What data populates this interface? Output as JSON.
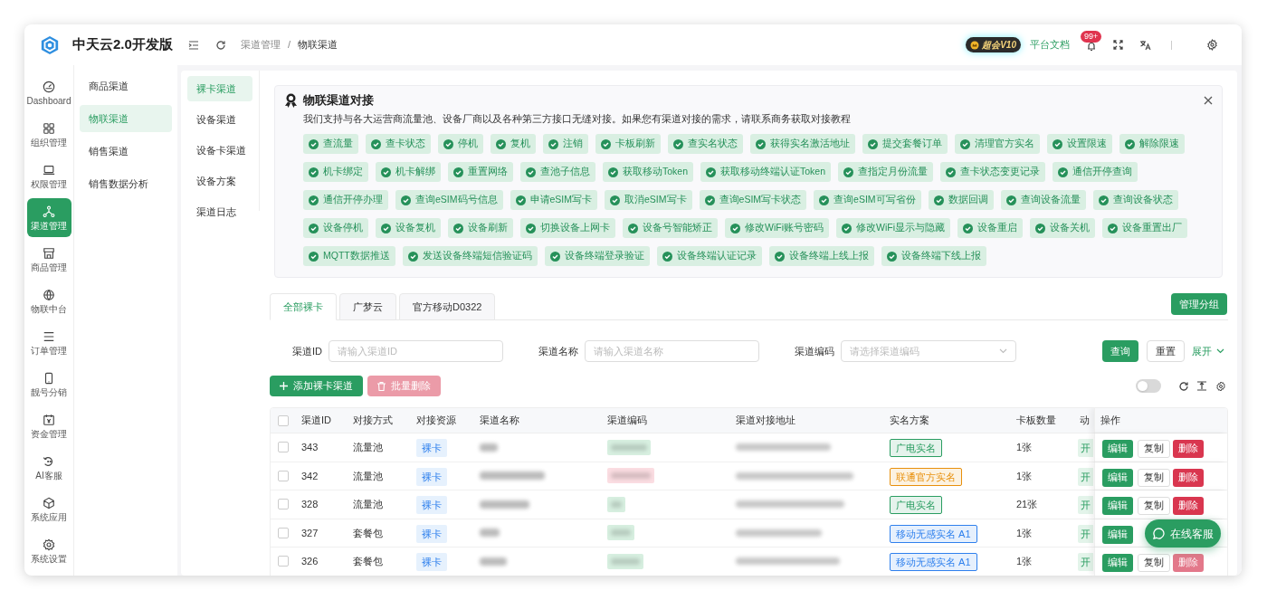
{
  "app": {
    "title": "中天云2.0开发版"
  },
  "rail": [
    {
      "label": "Dashboard",
      "selected": false
    },
    {
      "label": "组织管理",
      "selected": false
    },
    {
      "label": "权限管理",
      "selected": false
    },
    {
      "label": "渠道管理",
      "selected": true
    },
    {
      "label": "商品管理",
      "selected": false
    },
    {
      "label": "物联中台",
      "selected": false
    },
    {
      "label": "订单管理",
      "selected": false
    },
    {
      "label": "靓号分销",
      "selected": false
    },
    {
      "label": "资金管理",
      "selected": false
    },
    {
      "label": "AI客服",
      "selected": false
    },
    {
      "label": "系统应用",
      "selected": false
    },
    {
      "label": "系统设置",
      "selected": false
    }
  ],
  "submenu": [
    {
      "label": "商品渠道",
      "selected": false
    },
    {
      "label": "物联渠道",
      "selected": true
    },
    {
      "label": "销售渠道",
      "selected": false
    },
    {
      "label": "销售数据分析",
      "selected": false
    }
  ],
  "breadcrumb": [
    "渠道管理",
    "/",
    "物联渠道"
  ],
  "header": {
    "vip_badge": "超会V10",
    "docs_link": "平台文档",
    "notification_count": "99+"
  },
  "channel_menu": [
    {
      "label": "裸卡渠道",
      "selected": true
    },
    {
      "label": "设备渠道",
      "selected": false
    },
    {
      "label": "设备卡渠道",
      "selected": false
    },
    {
      "label": "设备方案",
      "selected": false
    },
    {
      "label": "渠道日志",
      "selected": false
    }
  ],
  "notice": {
    "title": "物联渠道对接",
    "description": "我们支持与各大运营商流量池、设备厂商以及各种第三方接口无缝对接。如果您有渠道对接的需求，请联系商务获取对接教程",
    "capabilities": [
      "查流量",
      "查卡状态",
      "停机",
      "复机",
      "注销",
      "卡板刷新",
      "查实名状态",
      "获得实名激活地址",
      "提交套餐订单",
      "清理官方实名",
      "设置限速",
      "解除限速",
      "机卡绑定",
      "机卡解绑",
      "重置网络",
      "查池子信息",
      "获取移动Token",
      "获取移动终端认证Token",
      "查指定月份流量",
      "查卡状态变更记录",
      "通信开停查询",
      "通信开停办理",
      "查询eSIM码号信息",
      "申请eSIM写卡",
      "取消eSIM写卡",
      "查询eSIM写卡状态",
      "查询eSIM可写省份",
      "数据回调",
      "查询设备流量",
      "查询设备状态",
      "设备停机",
      "设备复机",
      "设备刷新",
      "切换设备上网卡",
      "设备号智能矫正",
      "修改WiFi账号密码",
      "修改WiFi显示与隐藏",
      "设备重启",
      "设备关机",
      "设备重置出厂",
      "MQTT数据推送",
      "发送设备终端短信验证码",
      "设备终端登录验证",
      "设备终端认证记录",
      "设备终端上线上报",
      "设备终端下线上报"
    ]
  },
  "group_tabs": [
    {
      "label": "全部裸卡",
      "selected": true
    },
    {
      "label": "广梦云",
      "selected": false
    },
    {
      "label": "官方移动D0322",
      "selected": false
    }
  ],
  "manage_groups_button": "管理分组",
  "filters": [
    {
      "label": "渠道ID",
      "kind": "input",
      "placeholder": "请输入渠道ID"
    },
    {
      "label": "渠道名称",
      "kind": "input",
      "placeholder": "请输入渠道名称"
    },
    {
      "label": "渠道编码",
      "kind": "select",
      "placeholder": "请选择渠道编码"
    }
  ],
  "filter_actions": {
    "search": "查询",
    "reset": "重置",
    "expand": "展开"
  },
  "toolbar": {
    "add": {
      "label": "添加裸卡渠道",
      "disabled": false
    },
    "batch_delete": {
      "label": "批量删除",
      "disabled": true
    },
    "toggle": {
      "on": false
    }
  },
  "table": {
    "select_all": {
      "checked": false
    },
    "columns": [
      "渠道ID",
      "对接方式",
      "对接资源",
      "渠道名称",
      "渠道编码",
      "渠道对接地址",
      "实名方案",
      "卡板数量",
      "动",
      "操作"
    ],
    "rows": [
      {
        "checked": false,
        "id": "343",
        "method": "流量池",
        "resource": "裸卡",
        "code_tag": {
          "color": "#d7efe0"
        },
        "realname": {
          "text": "广电实名",
          "color": "#2a9d61"
        },
        "count": "1张",
        "status": "开",
        "actions": [
          {
            "kind": "edit",
            "label": "编辑",
            "disabled": false
          },
          {
            "kind": "copy",
            "label": "复制",
            "disabled": false
          },
          {
            "kind": "delete",
            "label": "删除",
            "disabled": false
          }
        ]
      },
      {
        "checked": false,
        "id": "342",
        "method": "流量池",
        "resource": "裸卡",
        "code_tag": {
          "color": "#fbdde2"
        },
        "realname": {
          "text": "联通官方实名",
          "color": "#e8900c"
        },
        "count": "1张",
        "status": "开",
        "actions": [
          {
            "kind": "edit",
            "label": "编辑",
            "disabled": false
          },
          {
            "kind": "copy",
            "label": "复制",
            "disabled": false
          },
          {
            "kind": "delete",
            "label": "删除",
            "disabled": false
          }
        ]
      },
      {
        "checked": false,
        "id": "328",
        "method": "流量池",
        "resource": "裸卡",
        "code_tag": {
          "color": "#d7efe0"
        },
        "realname": {
          "text": "广电实名",
          "color": "#2a9d61"
        },
        "count": "21张",
        "status": "开",
        "actions": [
          {
            "kind": "edit",
            "label": "编辑",
            "disabled": false
          },
          {
            "kind": "copy",
            "label": "复制",
            "disabled": false
          },
          {
            "kind": "delete",
            "label": "删除",
            "disabled": false
          }
        ]
      },
      {
        "checked": false,
        "id": "327",
        "method": "套餐包",
        "resource": "裸卡",
        "code_tag": {
          "color": "#d7efe0"
        },
        "realname": {
          "text": "移动无感实名 A1",
          "color": "#2f80ed"
        },
        "count": "1张",
        "status": "开",
        "actions": [
          {
            "kind": "edit",
            "label": "编辑",
            "disabled": false
          }
        ]
      },
      {
        "checked": false,
        "id": "326",
        "method": "套餐包",
        "resource": "裸卡",
        "code_tag": {
          "color": "#d7efe0"
        },
        "realname": {
          "text": "移动无感实名 A1",
          "color": "#2f80ed"
        },
        "count": "1张",
        "status": "开",
        "actions": [
          {
            "kind": "edit",
            "label": "编辑",
            "disabled": false
          },
          {
            "kind": "copy",
            "label": "复制",
            "disabled": false
          },
          {
            "kind": "delete",
            "label": "删除",
            "disabled": true
          }
        ]
      }
    ]
  },
  "chat_button": "在线客服"
}
